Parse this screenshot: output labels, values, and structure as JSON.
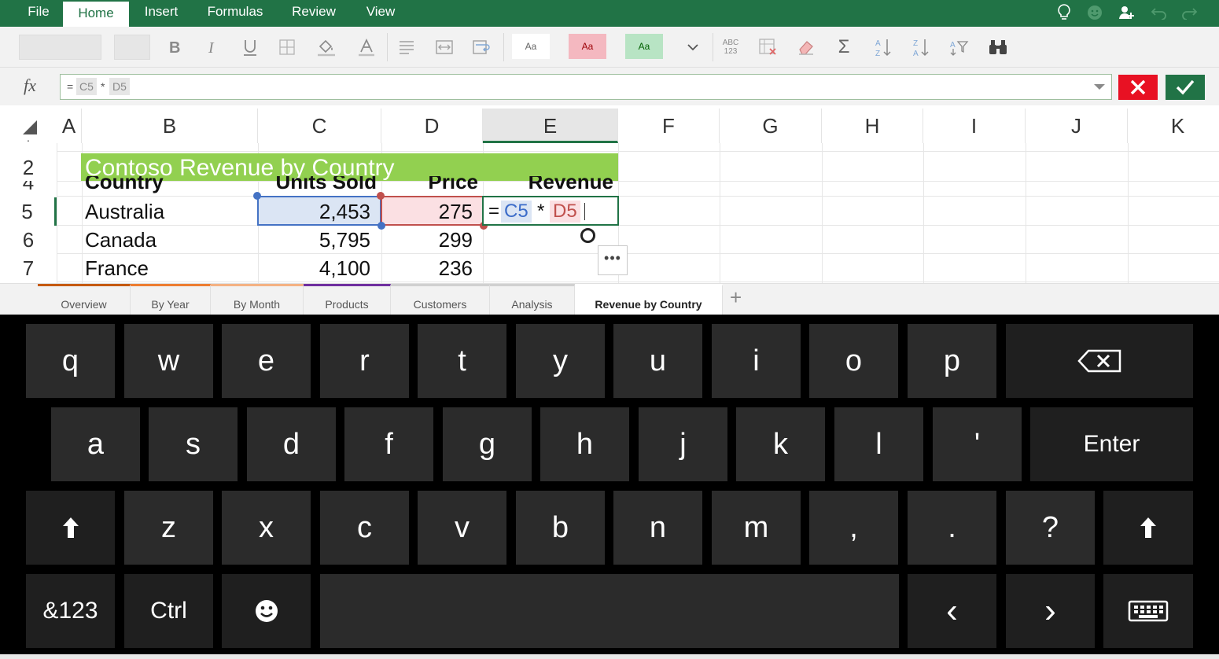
{
  "ribbon": {
    "tabs": [
      {
        "label": "File"
      },
      {
        "label": "Home"
      },
      {
        "label": "Insert"
      },
      {
        "label": "Formulas"
      },
      {
        "label": "Review"
      },
      {
        "label": "View"
      }
    ],
    "active_tab": "Home",
    "right_icons": [
      "lightbulb-icon",
      "smiley-feedback-icon",
      "share-user-icon",
      "undo-icon",
      "redo-icon"
    ],
    "toolbar": {
      "font_name": "",
      "font_size": "",
      "cell_styles": [
        {
          "label": "Aa",
          "bg": "#ffffff",
          "color": "#666666"
        },
        {
          "label": "Aa",
          "bg": "#f4b8c0",
          "color": "#9c0006"
        },
        {
          "label": "Aa",
          "bg": "#b8e4c4",
          "color": "#006100"
        }
      ],
      "spelling_label_top": "ABC",
      "spelling_label_bottom": "123",
      "sum_label": "Σ"
    }
  },
  "formula_bar": {
    "fx_label": "fx",
    "tokens": [
      {
        "text": "=",
        "kind": "plain"
      },
      {
        "text": "C5",
        "kind": "chip"
      },
      {
        "text": "*",
        "kind": "plain"
      },
      {
        "text": "D5",
        "kind": "chip"
      }
    ]
  },
  "grid": {
    "columns": [
      "A",
      "B",
      "C",
      "D",
      "E",
      "F",
      "G",
      "H",
      "I",
      "J",
      "K"
    ],
    "selected_column": "E",
    "rows": [
      {
        "header": "2",
        "cells": {
          "B": "Contoso Revenue by Country"
        }
      },
      {
        "header": "4",
        "cells": {
          "B": "Country",
          "C": "Units Sold",
          "D": "Price",
          "E": "Revenue"
        }
      },
      {
        "header": "5",
        "cells": {
          "B": "Australia",
          "C": "2,453",
          "D": "275"
        }
      },
      {
        "header": "6",
        "cells": {
          "B": "Canada",
          "C": "5,795",
          "D": "299"
        }
      },
      {
        "header": "7",
        "cells": {
          "B": "France",
          "C": "4,100",
          "D": "236"
        }
      }
    ],
    "editing": {
      "tokens": [
        {
          "text": "=",
          "kind": "plain"
        },
        {
          "text": "C5",
          "kind": "ref-blue"
        },
        {
          "text": "*",
          "kind": "plain"
        },
        {
          "text": "D5",
          "kind": "ref-red"
        }
      ]
    },
    "more_button_label": "•••"
  },
  "sheets": [
    {
      "label": "Overview",
      "color": "#c55a11"
    },
    {
      "label": "By Year",
      "color": "#ed7d31"
    },
    {
      "label": "By Month",
      "color": "#f4b183"
    },
    {
      "label": "Products",
      "color": "#7030a0"
    },
    {
      "label": "Customers",
      "color": "#d0d0d0"
    },
    {
      "label": "Analysis",
      "color": "#d0d0d0"
    },
    {
      "label": "Revenue by Country",
      "color": "#ffffff"
    }
  ],
  "active_sheet": "Revenue by Country",
  "add_sheet_label": "+",
  "keyboard": {
    "row1": [
      "q",
      "w",
      "e",
      "r",
      "t",
      "y",
      "u",
      "i",
      "o",
      "p"
    ],
    "row2": [
      "a",
      "s",
      "d",
      "f",
      "g",
      "h",
      "j",
      "k",
      "l",
      "'"
    ],
    "enter_label": "Enter",
    "row3": [
      "z",
      "x",
      "c",
      "v",
      "b",
      "n",
      "m",
      ",",
      ".",
      "?"
    ],
    "numbers_label": "&123",
    "ctrl_label": "Ctrl",
    "left_arrow": "‹",
    "right_arrow": "›"
  }
}
